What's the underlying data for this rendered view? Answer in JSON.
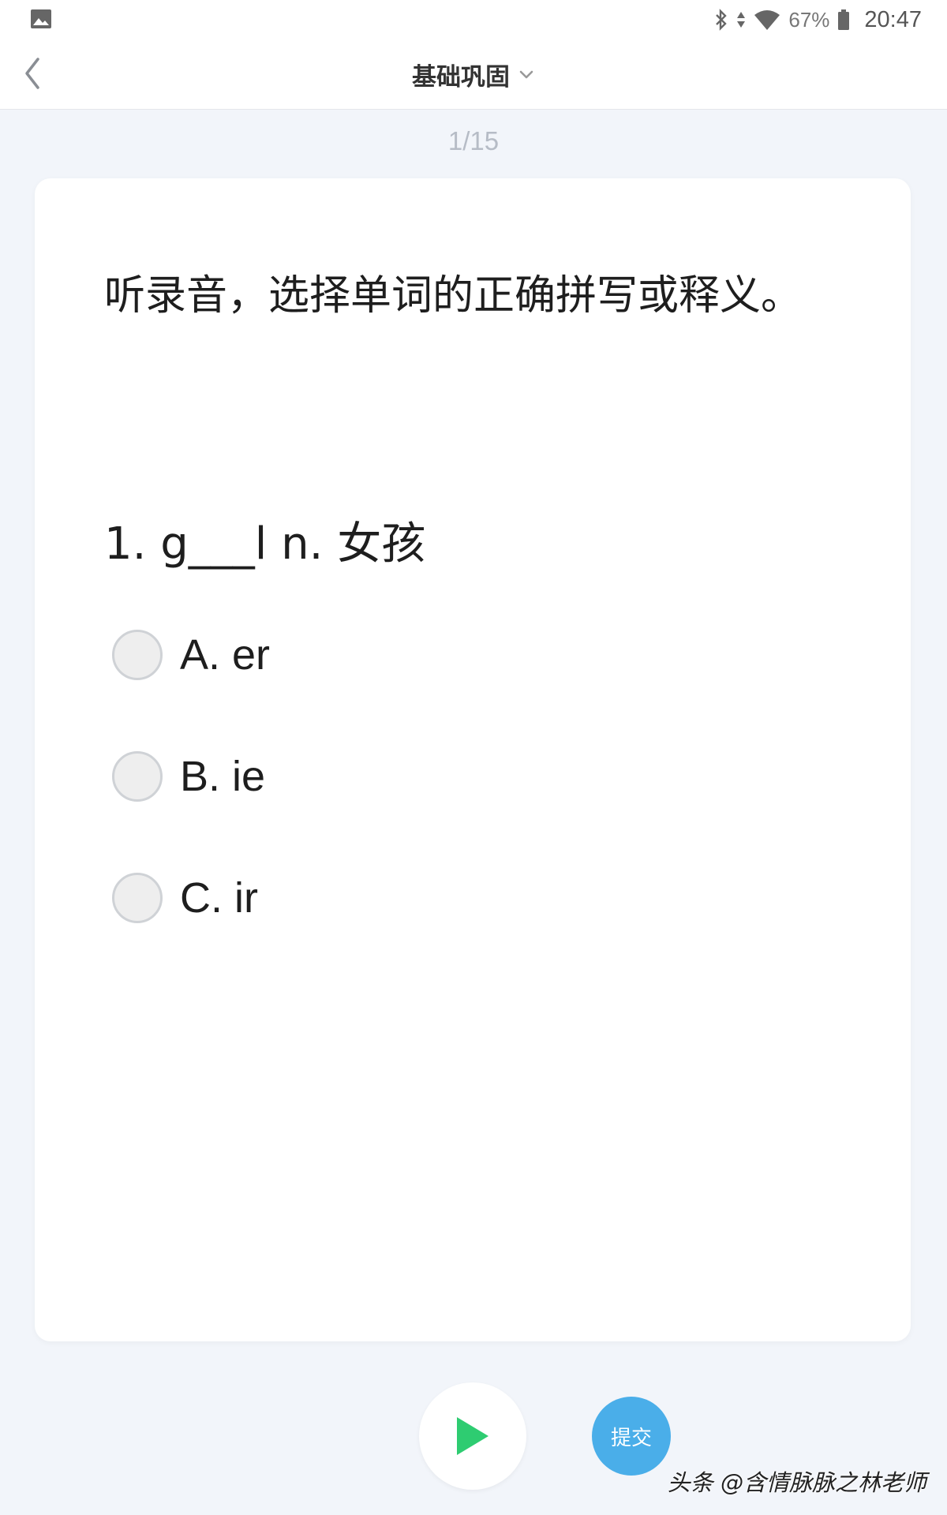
{
  "status_bar": {
    "battery_percent": "67%",
    "time": "20:47"
  },
  "header": {
    "title": "基础巩固"
  },
  "progress": {
    "text": "1/15",
    "current": 1,
    "total": 15
  },
  "question": {
    "instruction": "听录音，选择单词的正确拼写或释义。",
    "text": "1. g___l n. 女孩",
    "options": [
      {
        "label": "A. er",
        "selected": false
      },
      {
        "label": "B. ie",
        "selected": false
      },
      {
        "label": "C. ir",
        "selected": false
      }
    ]
  },
  "controls": {
    "submit_label": "提交"
  },
  "watermark": "头条 @含情脉脉之林老师",
  "colors": {
    "background": "#f2f5fa",
    "card": "#ffffff",
    "accent": "#4aaee9",
    "play_icon": "#2ecc71",
    "muted_text": "#b6bcc6"
  }
}
